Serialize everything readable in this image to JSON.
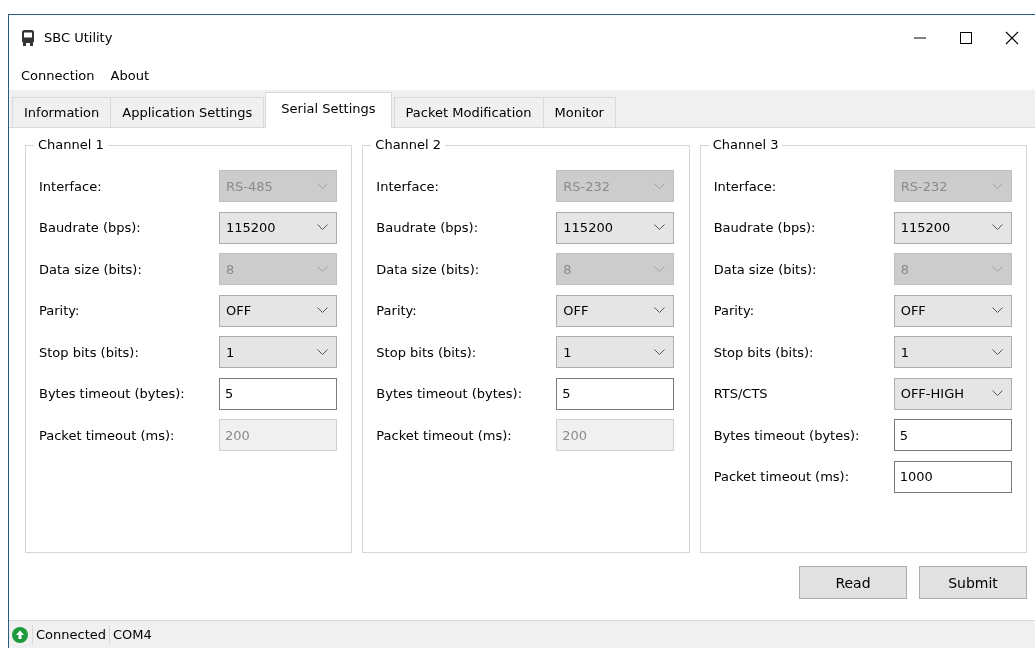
{
  "window": {
    "title": "SBC Utility"
  },
  "menu": [
    "Connection",
    "About"
  ],
  "tabs": [
    {
      "label": "Information",
      "selected": false
    },
    {
      "label": "Application Settings",
      "selected": false
    },
    {
      "label": "Serial Settings",
      "selected": true
    },
    {
      "label": "Packet Modification",
      "selected": false
    },
    {
      "label": "Monitor",
      "selected": false
    }
  ],
  "channels": [
    {
      "title": "Channel 1",
      "fields": [
        {
          "label": "Interface:",
          "kind": "select",
          "value": "RS-485",
          "disabled": true
        },
        {
          "label": "Baudrate (bps):",
          "kind": "select",
          "value": "115200",
          "disabled": false
        },
        {
          "label": "Data size (bits):",
          "kind": "select",
          "value": "8",
          "disabled": true
        },
        {
          "label": "Parity:",
          "kind": "select",
          "value": "OFF",
          "disabled": false
        },
        {
          "label": "Stop bits (bits):",
          "kind": "select",
          "value": "1",
          "disabled": false
        },
        {
          "label": "Bytes timeout (bytes):",
          "kind": "text",
          "value": "5",
          "disabled": false
        },
        {
          "label": "Packet timeout (ms):",
          "kind": "text",
          "value": "200",
          "disabled": true
        }
      ]
    },
    {
      "title": "Channel 2",
      "fields": [
        {
          "label": "Interface:",
          "kind": "select",
          "value": "RS-232",
          "disabled": true
        },
        {
          "label": "Baudrate (bps):",
          "kind": "select",
          "value": "115200",
          "disabled": false
        },
        {
          "label": "Data size (bits):",
          "kind": "select",
          "value": "8",
          "disabled": true
        },
        {
          "label": "Parity:",
          "kind": "select",
          "value": "OFF",
          "disabled": false
        },
        {
          "label": "Stop bits (bits):",
          "kind": "select",
          "value": "1",
          "disabled": false
        },
        {
          "label": "Bytes timeout (bytes):",
          "kind": "text",
          "value": "5",
          "disabled": false
        },
        {
          "label": "Packet timeout (ms):",
          "kind": "text",
          "value": "200",
          "disabled": true
        }
      ]
    },
    {
      "title": "Channel 3",
      "fields": [
        {
          "label": "Interface:",
          "kind": "select",
          "value": "RS-232",
          "disabled": true
        },
        {
          "label": "Baudrate (bps):",
          "kind": "select",
          "value": "115200",
          "disabled": false
        },
        {
          "label": "Data size (bits):",
          "kind": "select",
          "value": "8",
          "disabled": true
        },
        {
          "label": "Parity:",
          "kind": "select",
          "value": "OFF",
          "disabled": false
        },
        {
          "label": "Stop bits (bits):",
          "kind": "select",
          "value": "1",
          "disabled": false
        },
        {
          "label": "RTS/CTS",
          "kind": "select",
          "value": "OFF-HIGH",
          "disabled": false
        },
        {
          "label": "Bytes timeout (bytes):",
          "kind": "text",
          "value": "5",
          "disabled": false
        },
        {
          "label": "Packet timeout (ms):",
          "kind": "text",
          "value": "1000",
          "disabled": false
        }
      ]
    }
  ],
  "buttons": [
    "Read",
    "Submit"
  ],
  "status_bar": {
    "connected": true,
    "status": "Connected",
    "port": "COM4"
  }
}
